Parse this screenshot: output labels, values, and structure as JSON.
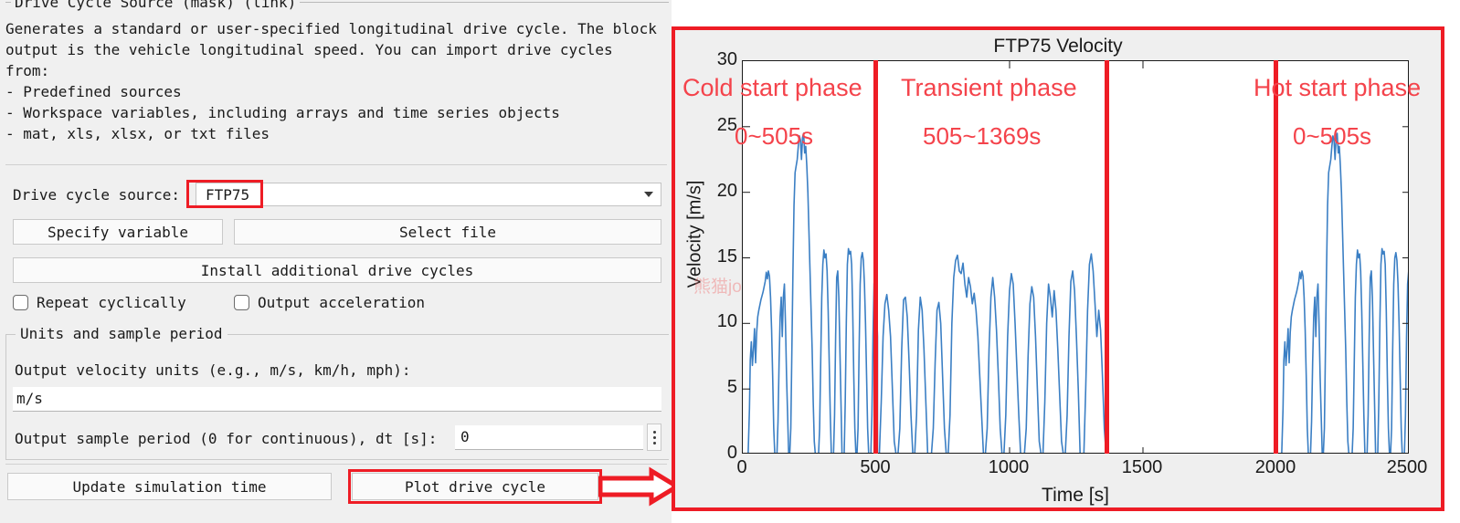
{
  "dialog": {
    "mask_title": "Drive Cycle Source (mask) (link)",
    "description": "Generates a standard or user-specified longitudinal drive cycle. The block\noutput is the vehicle longitudinal speed. You can import drive cycles\nfrom:\n- Predefined sources\n- Workspace variables, including arrays and time series objects\n- mat, xls, xlsx, or txt files",
    "source_label": "Drive cycle source:",
    "source_value": "FTP75",
    "btn_specify_variable": "Specify variable",
    "btn_select_file": "Select file",
    "btn_install_cycles": "Install additional drive cycles",
    "cb_repeat_label": "Repeat cyclically",
    "cb_repeat_checked": false,
    "cb_accel_label": "Output acceleration",
    "cb_accel_checked": false,
    "units_group_title": "Units and sample period",
    "velocity_units_label": "Output velocity units (e.g., m/s, km/h, mph):",
    "velocity_units_value": "m/s",
    "dt_label": "Output sample period (0 for continuous), dt [s]:",
    "dt_value": "0",
    "btn_update_sim": "Update simulation time",
    "btn_plot_cycle": "Plot drive cycle",
    "highlight_color": "#ee1c25"
  },
  "chart_data": {
    "type": "line",
    "title": "FTP75 Velocity",
    "xlabel": "Time [s]",
    "ylabel": "Velocity [m/s]",
    "xlim": [
      0,
      2500
    ],
    "ylim": [
      0,
      30
    ],
    "xticks": [
      0,
      500,
      1000,
      1500,
      2000,
      2500
    ],
    "yticks": [
      0,
      5,
      10,
      15,
      20,
      25,
      30
    ],
    "grid": false,
    "legend": "none",
    "line_color": "#3b7fc4",
    "series": [
      {
        "name": "FTP75 velocity",
        "x": [
          0,
          10,
          20,
          25,
          28,
          32,
          36,
          40,
          44,
          48,
          52,
          56,
          60,
          64,
          68,
          72,
          76,
          80,
          84,
          88,
          92,
          96,
          100,
          104,
          108,
          112,
          116,
          120,
          124,
          128,
          132,
          136,
          140,
          144,
          148,
          152,
          156,
          160,
          164,
          168,
          172,
          176,
          180,
          184,
          188,
          192,
          196,
          200,
          204,
          208,
          212,
          216,
          220,
          224,
          228,
          232,
          236,
          240,
          244,
          248,
          252,
          256,
          260,
          264,
          268,
          272,
          276,
          280,
          284,
          288,
          292,
          296,
          300,
          304,
          308,
          312,
          316,
          320,
          324,
          328,
          332,
          336,
          340,
          344,
          348,
          352,
          356,
          360,
          364,
          368,
          372,
          376,
          380,
          384,
          388,
          392,
          396,
          400,
          404,
          408,
          412,
          416,
          420,
          424,
          428,
          432,
          436,
          440,
          444,
          448,
          452,
          456,
          460,
          464,
          468,
          472,
          476,
          480,
          484,
          488,
          492,
          496,
          500,
          505
        ],
        "y": [
          0,
          0,
          0,
          3.5,
          7.2,
          8.6,
          6.8,
          8.0,
          9.6,
          7.0,
          9.3,
          10.5,
          11.0,
          11.4,
          11.8,
          12.1,
          12.4,
          12.8,
          13.2,
          13.9,
          13.4,
          14.0,
          13.6,
          12.0,
          9.5,
          6.0,
          2.0,
          0,
          0,
          0,
          2.5,
          7.0,
          10.5,
          12.0,
          9.0,
          12.0,
          13.0,
          10.0,
          6.0,
          3.0,
          0,
          0,
          2.0,
          8.0,
          14.0,
          19.0,
          21.5,
          22.0,
          22.5,
          23.5,
          24.3,
          24.0,
          22.5,
          24.2,
          24.5,
          23.0,
          23.5,
          22.0,
          20.0,
          17.0,
          14.0,
          11.0,
          8.0,
          4.0,
          1.0,
          0,
          0,
          0,
          0,
          2.0,
          7.0,
          12.0,
          14.5,
          15.6,
          15.0,
          15.3,
          14.0,
          11.0,
          7.0,
          3.0,
          0,
          0,
          0,
          3.0,
          9.0,
          13.5,
          14.0,
          12.0,
          8.0,
          4.0,
          0,
          0,
          0,
          4.0,
          10.0,
          14.5,
          15.7,
          15.3,
          15.5,
          14.5,
          11.0,
          6.0,
          2.0,
          0,
          0,
          2.0,
          8.0,
          13.0,
          15.0,
          15.4,
          14.8,
          13.0,
          10.0,
          6.0,
          2.0,
          0,
          0,
          0,
          3.0,
          9.0,
          13.0,
          14.0,
          12.0,
          9.0
        ]
      }
    ],
    "annotations": [
      {
        "name": "phase-divider-505",
        "type": "vline",
        "x": 505,
        "color": "#ee1c25"
      },
      {
        "name": "phase-divider-1369",
        "type": "vline",
        "x": 1369,
        "color": "#ee1c25"
      },
      {
        "name": "phase-divider-2000",
        "type": "vline",
        "x": 2000,
        "color": "#ee1c25"
      },
      {
        "name": "cold-start-phase",
        "label": "Cold start phase",
        "range": "0~505s",
        "color": "#f4434b"
      },
      {
        "name": "transient-phase",
        "label": "Transient phase",
        "range": "505~1369s",
        "color": "#f4434b"
      },
      {
        "name": "hot-start-phase",
        "label": "Hot start phase",
        "range": "0~505s",
        "color": "#f4434b"
      }
    ],
    "watermark": "熊猫jo"
  }
}
